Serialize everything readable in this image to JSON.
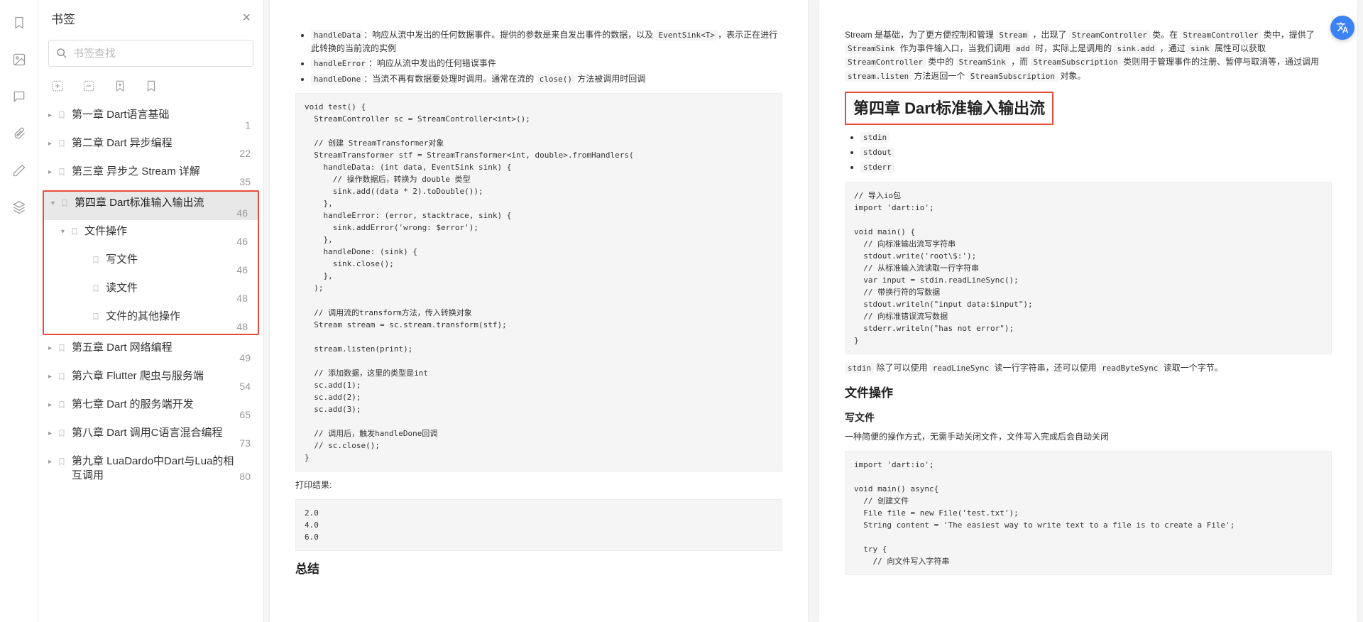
{
  "sidebar": {
    "title": "书签",
    "search_placeholder": "书签查找",
    "items": [
      {
        "label": "第一章 Dart语言基础",
        "page": "1",
        "depth": 0,
        "expanded": false,
        "hasChildren": true
      },
      {
        "label": "第二章 Dart 异步编程",
        "page": "22",
        "depth": 0,
        "expanded": false,
        "hasChildren": true
      },
      {
        "label": "第三章 异步之 Stream 详解",
        "page": "35",
        "depth": 0,
        "expanded": false,
        "hasChildren": true
      },
      {
        "label": "第四章 Dart标准输入输出流",
        "page": "46",
        "depth": 0,
        "expanded": true,
        "hasChildren": true,
        "active": true,
        "hlStart": true
      },
      {
        "label": "文件操作",
        "page": "46",
        "depth": 1,
        "expanded": true,
        "hasChildren": true
      },
      {
        "label": "写文件",
        "page": "46",
        "depth": 2,
        "expanded": false,
        "hasChildren": false
      },
      {
        "label": "读文件",
        "page": "48",
        "depth": 2,
        "expanded": false,
        "hasChildren": false
      },
      {
        "label": "文件的其他操作",
        "page": "48",
        "depth": 2,
        "expanded": false,
        "hasChildren": false,
        "hlEnd": true
      },
      {
        "label": "第五章 Dart 网络编程",
        "page": "49",
        "depth": 0,
        "expanded": false,
        "hasChildren": true
      },
      {
        "label": "第六章 Flutter 爬虫与服务端",
        "page": "54",
        "depth": 0,
        "expanded": false,
        "hasChildren": true
      },
      {
        "label": "第七章 Dart 的服务端开发",
        "page": "65",
        "depth": 0,
        "expanded": false,
        "hasChildren": true
      },
      {
        "label": "第八章 Dart 调用C语言混合编程",
        "page": "73",
        "depth": 0,
        "expanded": false,
        "hasChildren": true
      },
      {
        "label": "第九章 LuaDardo中Dart与Lua的相互调用",
        "page": "80",
        "depth": 0,
        "expanded": false,
        "hasChildren": true
      }
    ]
  },
  "leftPage": {
    "bullets": [
      {
        "label": "handleData",
        "desc": "：响应从流中发出的任何数据事件。提供的参数是来自发出事件的数据，以及 ",
        "code2": "EventSink<T>",
        "desc2": "，表示正在进行此转换的当前流的实例"
      },
      {
        "label": "handleError",
        "desc": "：响应从流中发出的任何错误事件"
      },
      {
        "label": "handleDone",
        "desc": "：当流不再有数据要处理时调用。通常在流的 ",
        "code2": "close()",
        "desc2": " 方法被调用时回调"
      }
    ],
    "code1": "void test() {\n  StreamController sc = StreamController<int>();\n\n  // 创建 StreamTransformer对象\n  StreamTransformer stf = StreamTransformer<int, double>.fromHandlers(\n    handleData: (int data, EventSink sink) {\n      // 操作数据后，转换为 double 类型\n      sink.add((data * 2).toDouble());\n    },\n    handleError: (error, stacktrace, sink) {\n      sink.addError('wrong: $error');\n    },\n    handleDone: (sink) {\n      sink.close();\n    },\n  );\n\n  // 调用流的transform方法，传入转换对象\n  Stream stream = sc.stream.transform(stf);\n\n  stream.listen(print);\n\n  // 添加数据，这里的类型是int\n  sc.add(1);\n  sc.add(2);\n  sc.add(3);\n\n  // 调用后，触发handleDone回调\n  // sc.close();\n}",
    "resultLabel": "打印结果:",
    "code2": "2.0\n4.0\n6.0",
    "summaryHeading": "总结"
  },
  "rightPage": {
    "intro": "Stream 是基础，为了更方便控制和管理 Stream ，出现了 StreamController 类。在 StreamController 类中，提供了 StreamSink 作为事件输入口，当我们调用 add 时，实际上是调用的 sink.add ，通过 sink 属性可以获取 StreamController 类中的 StreamSink ，而 StreamSubscription 类则用于管理事件的注册、暂停与取消等，通过调用 stream.listen 方法返回一个 StreamSubscription 对象。",
    "chapterTitle": "第四章 Dart标准输入输出流",
    "stdList": [
      "stdin",
      "stdout",
      "stderr"
    ],
    "code1": "// 导入io包\nimport 'dart:io';\n\nvoid main() {\n  // 向标准输出流写字符串\n  stdout.write('root\\$:');\n  // 从标准输入流读取一行字符串\n  var input = stdin.readLineSync();\n  // 带换行符的写数据\n  stdout.writeln(\"input data:$input\");\n  // 向标准错误流写数据\n  stderr.writeln(\"has not error\");\n}",
    "stdinNote": "stdin 除了可以使用 readLineSync 读一行字符串，还可以使用 readByteSync 读取一个字节。",
    "fileHeading": "文件操作",
    "writeHeading": "写文件",
    "writeDesc": "一种简便的操作方式，无需手动关闭文件，文件写入完成后会自动关闭",
    "code2": "import 'dart:io';\n\nvoid main() async{\n  // 创建文件\n  File file = new File('test.txt');\n  String content = 'The easiest way to write text to a file is to create a File';\n\n  try {\n    // 向文件写入字符串"
  }
}
